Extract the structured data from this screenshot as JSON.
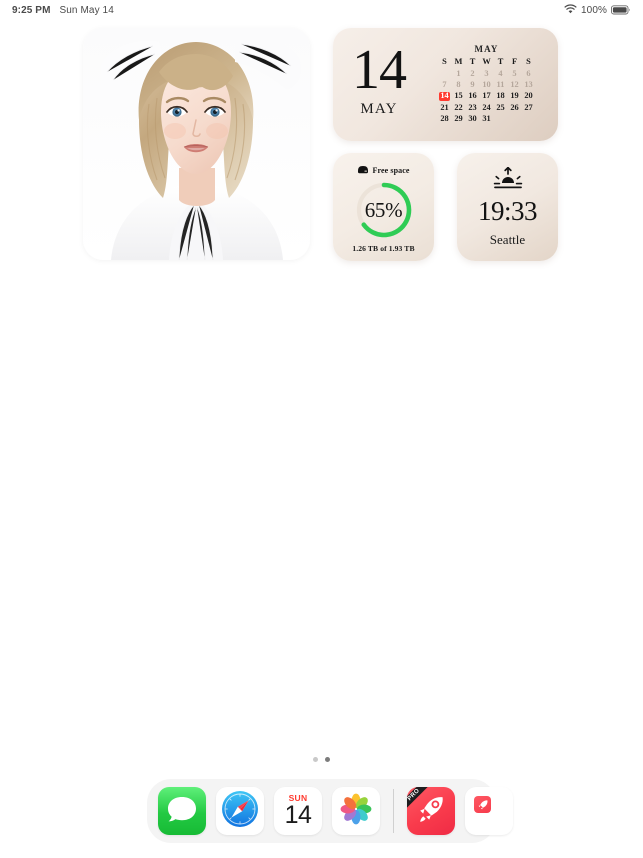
{
  "status_bar": {
    "time": "9:25 PM",
    "date": "Sun May 14",
    "wifi_icon": "wifi-icon",
    "battery_percent": "100%",
    "battery_icon": "battery-full-icon"
  },
  "widgets": {
    "photo": {
      "name": "photo-widget",
      "description": "Portrait photo of a blonde woman in white clothing on a white background"
    },
    "calendar": {
      "day_number": "14",
      "month_label": "MAY",
      "month_title": "MAY",
      "weekday_headers": [
        "S",
        "M",
        "T",
        "W",
        "T",
        "F",
        "S"
      ],
      "weeks": [
        [
          {
            "d": "",
            "state": "blank"
          },
          {
            "d": "1",
            "state": "past"
          },
          {
            "d": "2",
            "state": "past"
          },
          {
            "d": "3",
            "state": "past"
          },
          {
            "d": "4",
            "state": "past"
          },
          {
            "d": "5",
            "state": "past"
          },
          {
            "d": "6",
            "state": "past"
          }
        ],
        [
          {
            "d": "7",
            "state": "past"
          },
          {
            "d": "8",
            "state": "past"
          },
          {
            "d": "9",
            "state": "past"
          },
          {
            "d": "10",
            "state": "past"
          },
          {
            "d": "11",
            "state": "past"
          },
          {
            "d": "12",
            "state": "past"
          },
          {
            "d": "13",
            "state": "past"
          }
        ],
        [
          {
            "d": "14",
            "state": "today"
          },
          {
            "d": "15",
            "state": "normal"
          },
          {
            "d": "16",
            "state": "normal"
          },
          {
            "d": "17",
            "state": "normal"
          },
          {
            "d": "18",
            "state": "normal"
          },
          {
            "d": "19",
            "state": "normal"
          },
          {
            "d": "20",
            "state": "normal"
          }
        ],
        [
          {
            "d": "21",
            "state": "normal"
          },
          {
            "d": "22",
            "state": "normal"
          },
          {
            "d": "23",
            "state": "normal"
          },
          {
            "d": "24",
            "state": "normal"
          },
          {
            "d": "25",
            "state": "normal"
          },
          {
            "d": "26",
            "state": "normal"
          },
          {
            "d": "27",
            "state": "normal"
          }
        ],
        [
          {
            "d": "28",
            "state": "normal"
          },
          {
            "d": "29",
            "state": "normal"
          },
          {
            "d": "30",
            "state": "normal"
          },
          {
            "d": "31",
            "state": "normal"
          },
          {
            "d": "",
            "state": "blank"
          },
          {
            "d": "",
            "state": "blank"
          },
          {
            "d": "",
            "state": "blank"
          }
        ]
      ],
      "today_color": "#ff3b30"
    },
    "free_space": {
      "icon": "hard-drive-icon",
      "title": "Free space",
      "percent_label": "65%",
      "percent_value": 65,
      "detail": "1.26 TB of 1.93 TB",
      "arc_color": "#2fcc55",
      "track_color": "#e8ded4"
    },
    "sunrise": {
      "icon": "sunrise-icon",
      "time": "19:33",
      "city": "Seattle"
    }
  },
  "page_indicator": {
    "count": 2,
    "active_index": 1
  },
  "dock": {
    "apps": [
      {
        "name": "messages",
        "label": "Messages"
      },
      {
        "name": "safari",
        "label": "Safari"
      },
      {
        "name": "calendar",
        "label": "Calendar",
        "day_of_week": "SUN",
        "day_number": "14"
      },
      {
        "name": "photos",
        "label": "Photos"
      }
    ],
    "recents": [
      {
        "name": "rocket-pro",
        "label": "Rocket",
        "badge": "PRO"
      },
      {
        "name": "rocket-document",
        "label": "Rocket Document"
      }
    ]
  }
}
